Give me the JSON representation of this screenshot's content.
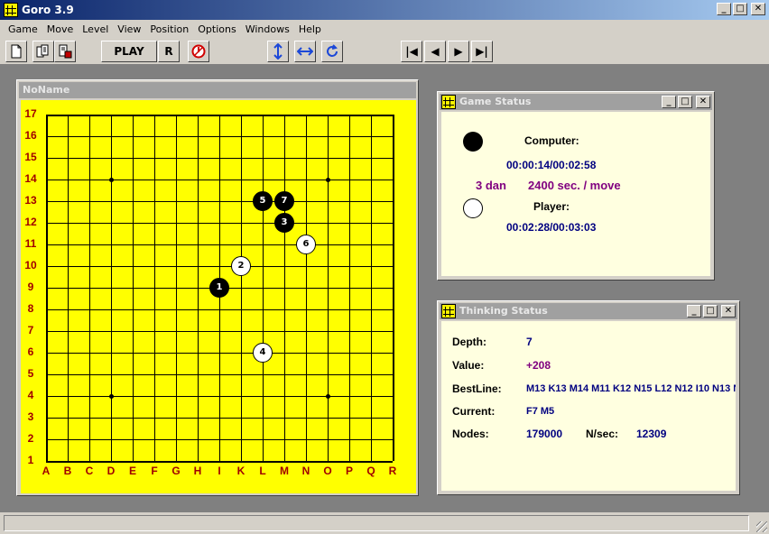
{
  "app": {
    "title": "Goro 3.9"
  },
  "window_controls": {
    "minimize": "_",
    "maximize": "□",
    "close": "✕"
  },
  "menu": [
    "Game",
    "Move",
    "Level",
    "View",
    "Position",
    "Options",
    "Windows",
    "Help"
  ],
  "toolbar": {
    "play_label": "PLAY",
    "r_label": "R",
    "icons": [
      "new-document-icon",
      "copy-document-icon",
      "save-document-icon",
      "stop-icon",
      "flip-vertical-icon",
      "flip-horizontal-icon",
      "rotate-icon",
      "first-move-icon",
      "prev-move-icon",
      "next-move-icon",
      "last-move-icon"
    ],
    "nav_glyphs": {
      "first": "|◀",
      "prev": "◀",
      "next": "▶",
      "last": "▶|"
    }
  },
  "board": {
    "title": "NoName",
    "size": 17,
    "columns": [
      "A",
      "B",
      "C",
      "D",
      "E",
      "F",
      "G",
      "H",
      "I",
      "K",
      "L",
      "M",
      "N",
      "O",
      "P",
      "Q",
      "R"
    ],
    "rows": [
      "17",
      "16",
      "15",
      "14",
      "13",
      "12",
      "11",
      "10",
      "9",
      "8",
      "7",
      "6",
      "5",
      "4",
      "3",
      "2",
      "1"
    ],
    "star_points": [
      "D14",
      "O14",
      "D4",
      "O4"
    ],
    "stones": [
      {
        "num": "1",
        "color": "black",
        "col": "I",
        "row": 9
      },
      {
        "num": "2",
        "color": "white",
        "col": "K",
        "row": 10
      },
      {
        "num": "3",
        "color": "black",
        "col": "M",
        "row": 12
      },
      {
        "num": "4",
        "color": "white",
        "col": "L",
        "row": 6
      },
      {
        "num": "5",
        "color": "black",
        "col": "L",
        "row": 13
      },
      {
        "num": "6",
        "color": "white",
        "col": "N",
        "row": 11
      },
      {
        "num": "7",
        "color": "black",
        "col": "M",
        "row": 13
      }
    ],
    "colors": {
      "board": "#ffff00",
      "coords": "#a00000"
    }
  },
  "game_status": {
    "title": "Game Status",
    "computer_label": "Computer:",
    "computer_time": "00:00:14/00:02:58",
    "level": "3 dan",
    "time_per_move": "2400 sec. / move",
    "player_label": "Player:",
    "player_time": "00:02:28/00:03:03"
  },
  "thinking_status": {
    "title": "Thinking Status",
    "depth_label": "Depth:",
    "depth": "7",
    "value_label": "Value:",
    "value": "+208",
    "bestline_label": "BestLine:",
    "bestline": "M13 K13 M14 M11 K12 N15 L12 N12 I10 N13 N",
    "current_label": "Current:",
    "current": "F7 M5",
    "nodes_label": "Nodes:",
    "nodes": "179000",
    "nsec_label": "N/sec:",
    "nsec": "12309"
  }
}
